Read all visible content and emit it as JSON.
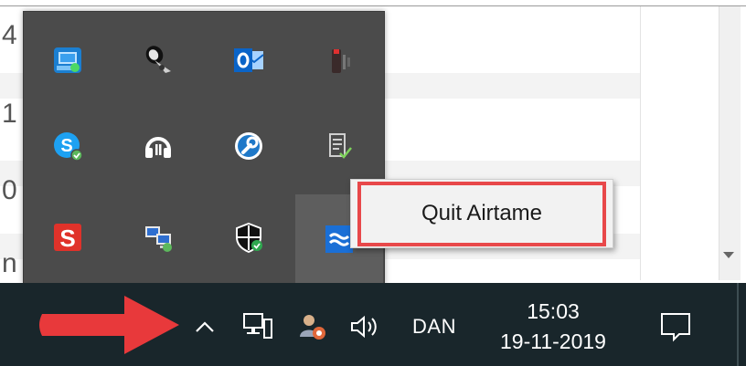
{
  "background_app": {
    "row_digits": [
      "4",
      "1",
      "0",
      "n"
    ]
  },
  "tray_overflow": {
    "icons": [
      [
        "network-sharing-icon",
        "satellite-dish-icon",
        "outlook-icon",
        "red-device-icon"
      ],
      [
        "skype-icon",
        "headset-icon",
        "blue-wrench-icon",
        "checklist-icon"
      ],
      [
        "snagit-icon",
        "network-computers-icon",
        "security-shield-icon",
        "airtame-icon"
      ]
    ]
  },
  "context_menu": {
    "items": [
      "Quit Airtame"
    ]
  },
  "taskbar": {
    "language": "DAN",
    "time": "15:03",
    "date": "19-11-2019"
  },
  "colors": {
    "taskbar_bg": "#19262b",
    "flyout_bg": "#4b4b4b",
    "highlight_red": "#e8484a",
    "airtame_blue": "#1a6fd6"
  }
}
